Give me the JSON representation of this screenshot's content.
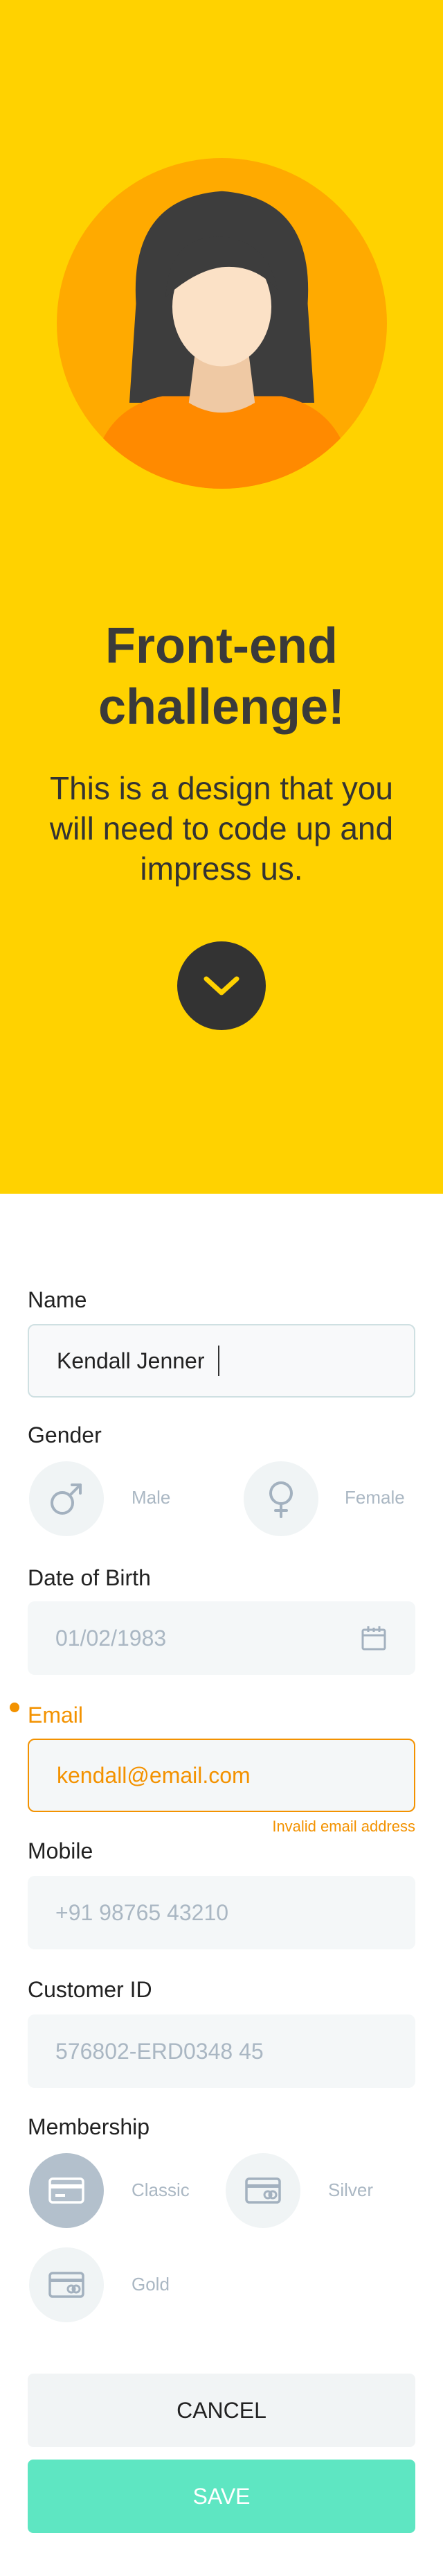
{
  "colors": {
    "hero_bg": "#ffd200",
    "avatar_circle": "#ffaa00",
    "title_text": "#3a3a3a",
    "accent_orange": "#f39200",
    "save_button": "#5ee6c2",
    "field_bg": "#f4f7f8",
    "placeholder_text": "#aab7c3"
  },
  "hero": {
    "title": "Front-end\nchallenge!",
    "subtitle": "This is a design that you will need to code up and impress us.",
    "scroll_icon": "chevron-down-icon"
  },
  "form": {
    "name": {
      "label": "Name",
      "value": "Kendall Jenner"
    },
    "gender": {
      "label": "Gender",
      "options": [
        {
          "label": "Male",
          "icon": "male-icon"
        },
        {
          "label": "Female",
          "icon": "female-icon"
        }
      ]
    },
    "dob": {
      "label": "Date of Birth",
      "value": "01/02/1983",
      "icon": "calendar-icon"
    },
    "email": {
      "label": "Email",
      "value": "kendall@email.com",
      "error": "Invalid email address"
    },
    "mobile": {
      "label": "Mobile",
      "placeholder": "+91 98765 43210"
    },
    "customer_id": {
      "label": "Customer ID",
      "placeholder": "576802-ERD0348 45"
    },
    "membership": {
      "label": "Membership",
      "options": [
        {
          "label": "Classic",
          "icon": "credit-card-icon",
          "selected": true
        },
        {
          "label": "Silver",
          "icon": "card-icon",
          "selected": false
        },
        {
          "label": "Gold",
          "icon": "card-icon",
          "selected": false
        }
      ]
    }
  },
  "actions": {
    "cancel_label": "CANCEL",
    "save_label": "SAVE"
  }
}
